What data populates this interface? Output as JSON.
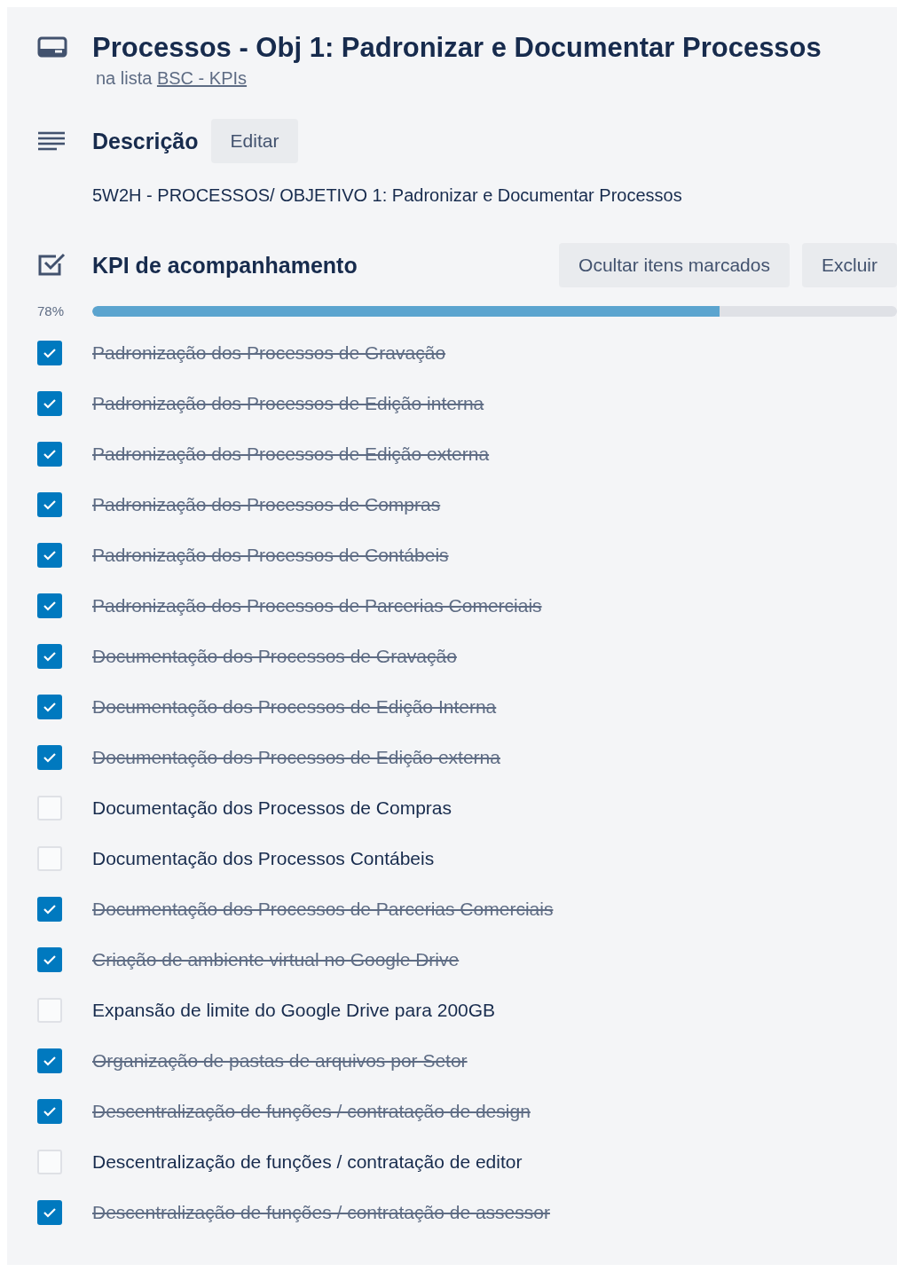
{
  "card": {
    "title": "Processos - Obj 1: Padronizar e Documentar Processos",
    "list_prefix": "na lista",
    "list_link": "BSC - KPIs"
  },
  "description": {
    "heading": "Descrição",
    "edit_button": "Editar",
    "text": "5W2H - PROCESSOS/ OBJETIVO 1: Padronizar e Documentar Processos"
  },
  "checklist": {
    "title": "KPI de acompanhamento",
    "buttons": [
      "Ocultar itens marcados",
      "Excluir"
    ],
    "percent": "78%",
    "level": 0.78,
    "items": [
      {
        "label": "Padronização dos Processos de Gravação",
        "checked": true
      },
      {
        "label": "Padronização dos Processos de Edição interna",
        "checked": true
      },
      {
        "label": "Padronização dos Processos de Edição externa",
        "checked": true
      },
      {
        "label": "Padronização dos Processos de Compras",
        "checked": true
      },
      {
        "label": "Padronização dos Processos de Contábeis",
        "checked": true
      },
      {
        "label": "Padronização dos Processos de Parcerias Comerciais",
        "checked": true
      },
      {
        "label": "Documentação dos Processos de Gravação",
        "checked": true
      },
      {
        "label": "Documentação dos Processos de Edição Interna",
        "checked": true
      },
      {
        "label": "Documentação dos Processos de Edição externa",
        "checked": true
      },
      {
        "label": "Documentação dos Processos de Compras",
        "checked": false
      },
      {
        "label": "Documentação dos Processos Contábeis",
        "checked": false
      },
      {
        "label": "Documentação dos Processos de Parcerias Comerciais",
        "checked": true
      },
      {
        "label": "Criação de ambiente virtual no Google Drive",
        "checked": true
      },
      {
        "label": "Expansão de limite do Google Drive para 200GB",
        "checked": false
      },
      {
        "label": "Organização de pastas de arquivos por Setor",
        "checked": true
      },
      {
        "label": "Descentralização de funções / contratação de design",
        "checked": true
      },
      {
        "label": "Descentralização de funções / contratação de editor",
        "checked": false
      },
      {
        "label": "Descentralização de funções / contratação de assessor",
        "checked": true
      }
    ]
  }
}
